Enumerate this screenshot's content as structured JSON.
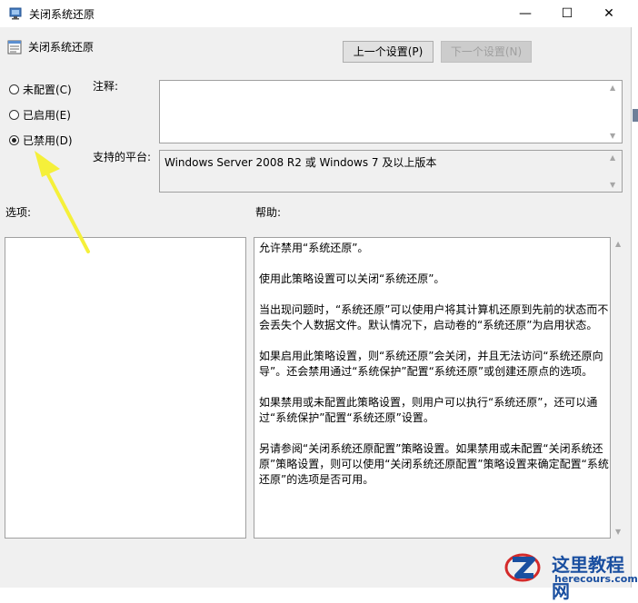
{
  "window": {
    "title": "关闭系统还原",
    "controls": {
      "minimize": "—",
      "maximize": "☐",
      "close": "✕"
    }
  },
  "header": {
    "setting_name": "关闭系统还原",
    "prev_button": "上一个设置(P)",
    "next_button": "下一个设置(N)"
  },
  "state": {
    "options": [
      {
        "label": "未配置(C)",
        "selected": false
      },
      {
        "label": "已启用(E)",
        "selected": false
      },
      {
        "label": "已禁用(D)",
        "selected": true
      }
    ]
  },
  "comment": {
    "label": "注释:",
    "value": ""
  },
  "platform": {
    "label": "支持的平台:",
    "value": "Windows Server 2008 R2 或 Windows 7 及以上版本"
  },
  "options_panel": {
    "label": "选项:"
  },
  "help": {
    "label": "帮助:",
    "paragraphs": [
      "允许禁用“系统还原”。",
      "使用此策略设置可以关闭“系统还原”。",
      "当出现问题时，“系统还原”可以使用户将其计算机还原到先前的状态而不会丢失个人数据文件。默认情况下，启动卷的“系统还原”为启用状态。",
      "如果启用此策略设置，则“系统还原”会关闭，并且无法访问“系统还原向导”。还会禁用通过“系统保护”配置“系统还原”或创建还原点的选项。",
      "如果禁用或未配置此策略设置，则用户可以执行“系统还原”，还可以通过“系统保护”配置“系统还原”设置。",
      "另请参阅“关闭系统还原配置”策略设置。如果禁用或未配置“关闭系统还原”策略设置，则可以使用“关闭系统还原配置”策略设置来确定配置“系统还原”的选项是否可用。"
    ]
  },
  "watermark": {
    "name": "这里教程网",
    "url": "herecours.com"
  },
  "colors": {
    "annotation_arrow": "#f5f03a",
    "watermark_blue": "#1a4fa0",
    "watermark_red": "#d42a2a"
  }
}
